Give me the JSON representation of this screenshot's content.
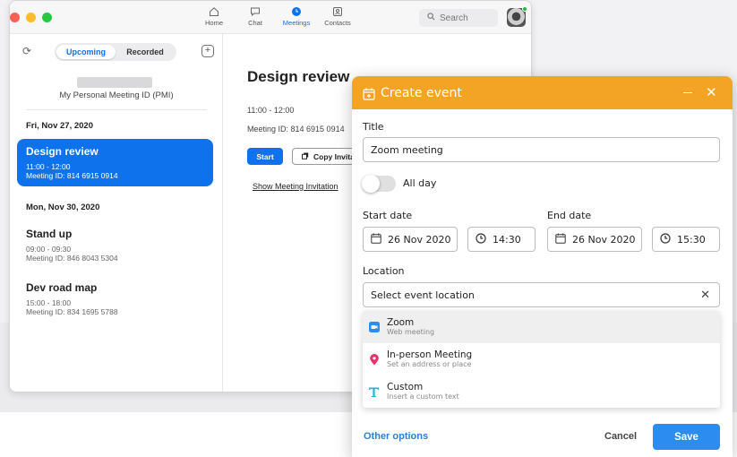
{
  "window": {
    "nav": [
      {
        "label": "Home",
        "icon": "home-icon"
      },
      {
        "label": "Chat",
        "icon": "chat-icon"
      },
      {
        "label": "Meetings",
        "icon": "clock-icon",
        "active": true
      },
      {
        "label": "Contacts",
        "icon": "contacts-icon"
      }
    ],
    "search_placeholder": "Search",
    "status_color": "#2ab744"
  },
  "left": {
    "tabs": {
      "upcoming": "Upcoming",
      "recorded": "Recorded"
    },
    "pmi_label": "My Personal Meeting ID (PMI)",
    "groups": [
      {
        "date": "Fri, Nov 27, 2020",
        "meetings": [
          {
            "title": "Design review",
            "time": "11:00 - 12:00",
            "meeting_id": "Meeting ID: 814 6915 0914",
            "selected": true
          }
        ]
      },
      {
        "date": "Mon, Nov 30, 2020",
        "meetings": [
          {
            "title": "Stand up",
            "time": "09:00 - 09:30",
            "meeting_id": "Meeting ID: 846 8043 5304"
          },
          {
            "title": "Dev road map",
            "time": "15:00 - 18:00",
            "meeting_id": "Meeting ID: 834 1695 5788"
          }
        ]
      }
    ]
  },
  "detail": {
    "title": "Design review",
    "time": "11:00 - 12:00",
    "meeting_id": "Meeting ID: 814 6915 0914",
    "start_label": "Start",
    "copy_label": "Copy Invitation",
    "show_invitation": "Show Meeting Invitation"
  },
  "dialog": {
    "title": "Create event",
    "header_color": "#f4a424",
    "title_label": "Title",
    "title_value": "Zoom meeting",
    "allday_label": "All day",
    "allday_on": false,
    "start_label": "Start date",
    "end_label": "End date",
    "start_date": "26 Nov 2020",
    "start_time": "14:30",
    "end_date": "26 Nov 2020",
    "end_time": "15:30",
    "location_label": "Location",
    "location_placeholder": "Select event location",
    "options": [
      {
        "title": "Zoom",
        "subtitle": "Web meeting",
        "icon": "zoom-camera-icon",
        "highlighted": true
      },
      {
        "title": "In-person Meeting",
        "subtitle": "Set an address or place",
        "icon": "map-pin-icon"
      },
      {
        "title": "Custom",
        "subtitle": "Insert a custom text",
        "icon": "text-t-icon"
      }
    ],
    "other_options": "Other options",
    "cancel": "Cancel",
    "save": "Save",
    "save_color": "#2d8cf0"
  }
}
